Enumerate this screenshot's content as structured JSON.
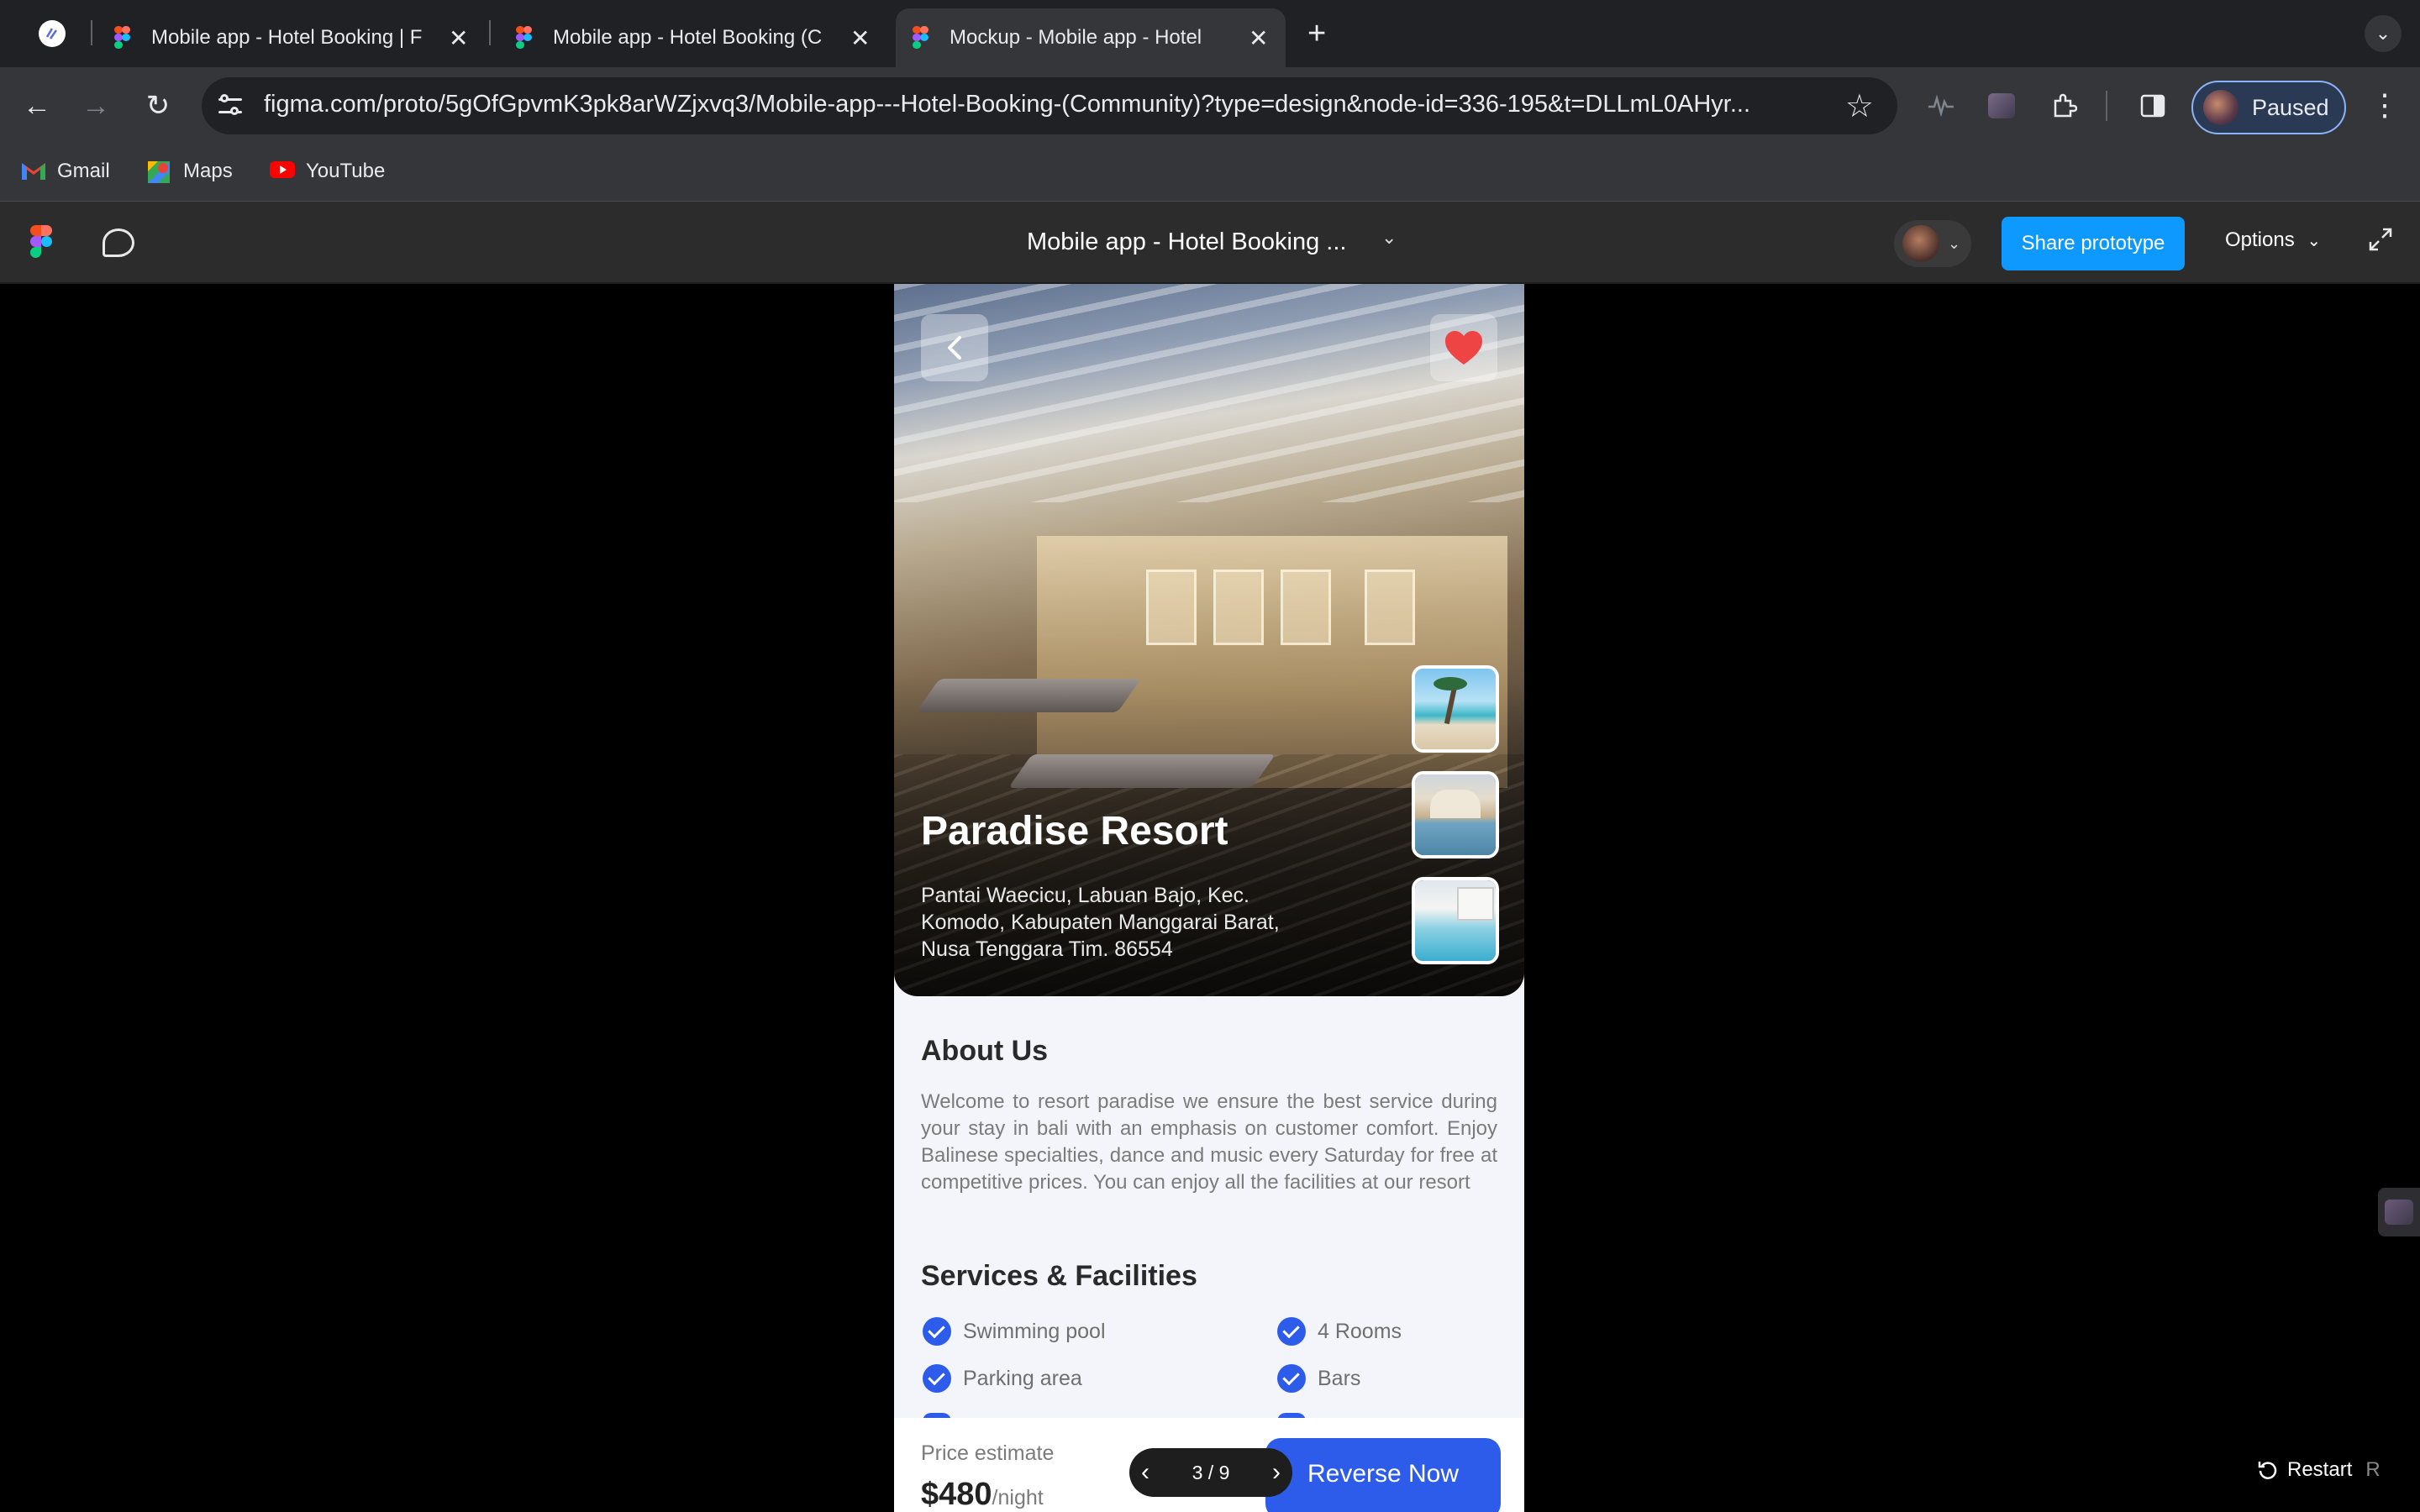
{
  "browser": {
    "tabs": [
      {
        "title": "Mobile app - Hotel Booking | F"
      },
      {
        "title": "Mobile app - Hotel Booking (C"
      },
      {
        "title": "Mockup - Mobile app - Hotel"
      }
    ],
    "url": "figma.com/proto/5gOfGpvmK3pk8arWZjxvq3/Mobile-app---Hotel-Booking-(Community)?type=design&node-id=336-195&t=DLLmL0AHyr...",
    "profile_label": "Paused",
    "bookmarks": [
      {
        "label": "Gmail"
      },
      {
        "label": "Maps"
      },
      {
        "label": "YouTube"
      }
    ]
  },
  "figma": {
    "file_title": "Mobile app - Hotel Booking ...",
    "share_label": "Share prototype",
    "options_label": "Options",
    "pager": "3 / 9",
    "restart_label": "Restart",
    "restart_key": "R"
  },
  "app": {
    "hotel_name": "Paradise Resort",
    "address": "Pantai Waecicu, Labuan Bajo, Kec. Komodo, Kabupaten Manggarai Barat, Nusa Tenggara Tim. 86554",
    "about_title": "About Us",
    "about_text": "Welcome to resort paradise we ensure the best service during your stay in bali with an emphasis on customer comfort. Enjoy Balinese specialties, dance and music every Saturday for free at competitive prices. You can enjoy all the facilities at our resort",
    "services_title": "Services & Facilities",
    "services": [
      {
        "label": "Swimming pool"
      },
      {
        "label": "4 Rooms"
      },
      {
        "label": "Parking area"
      },
      {
        "label": "Bars"
      }
    ],
    "price_label": "Price estimate",
    "price": "$480",
    "price_unit": "/night",
    "cta_label": "Reverse Now",
    "favorite": true
  },
  "colors": {
    "accent": "#2d5bea",
    "figma_blue": "#0d99ff",
    "heart": "#ef4444"
  }
}
